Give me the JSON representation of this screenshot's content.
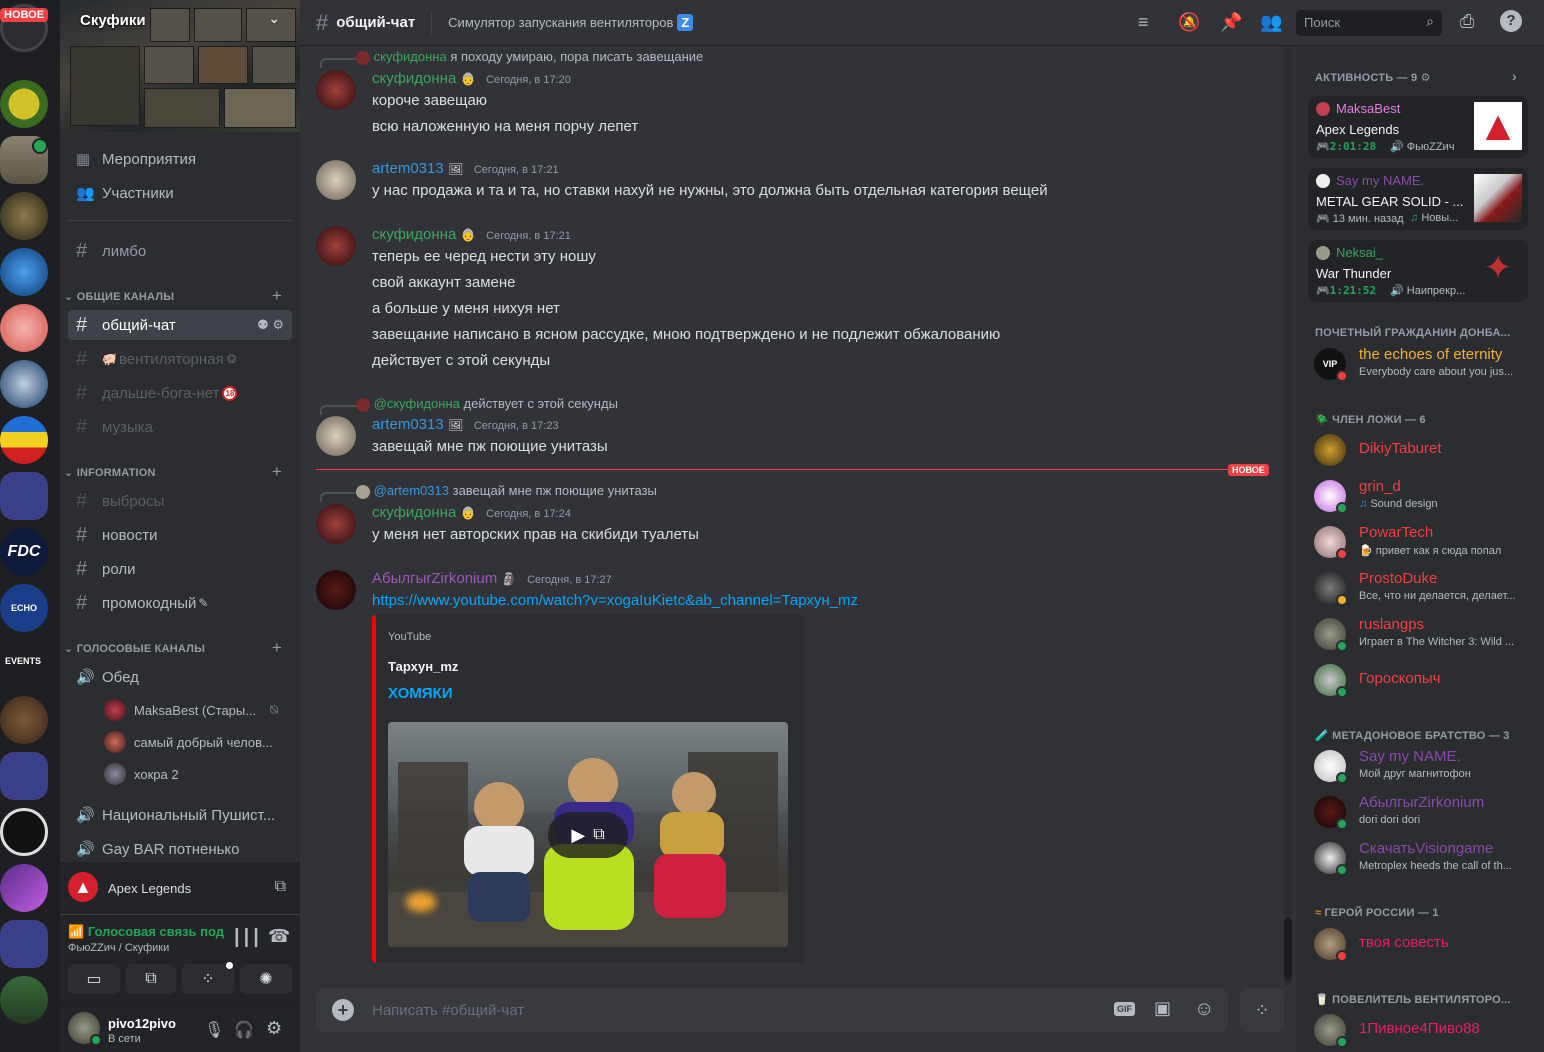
{
  "servers": {
    "new_badge": "НОВОЕ",
    "events_label": "EVENTS"
  },
  "server": {
    "name": "Скуфики"
  },
  "nav": {
    "events": "Мероприятия",
    "members": "Участники"
  },
  "channels": {
    "top": [
      {
        "name": "лимбо"
      }
    ],
    "categories": [
      {
        "name": "ОБЩИЕ КАНАЛЫ",
        "channels": [
          "общий-чат",
          "вентиляторная",
          "дальше-бога-нет",
          "музыка"
        ]
      },
      {
        "name": "INFORMATION",
        "channels": [
          "выбросы",
          "новости",
          "роли",
          "промокодный"
        ]
      },
      {
        "name": "ГОЛОСОВЫЕ КАНАЛЫ",
        "channels": [
          "Обед",
          "Национальный Пушист...",
          "Gay BAR потненько"
        ]
      }
    ],
    "voice_users": [
      "MaksaBest (Стары...",
      "самый добрый челов...",
      "хокра 2"
    ]
  },
  "activity_panel": {
    "game": "Apex Legends"
  },
  "voice_status": {
    "title": "Голосовая связь под",
    "subtitle": "ФьюZZич / Скуфики"
  },
  "user_panel": {
    "name": "pivo12pivo",
    "status": "В сети"
  },
  "topbar": {
    "channel": "общий-чат",
    "topic": "Симулятор запускания вентиляторов",
    "topic_badge": "Z",
    "search_placeholder": "Поиск"
  },
  "messages": [
    {
      "reply_name": "скуфидонна",
      "reply_text": "я походу умираю, пора писать завещание",
      "author": "скуфидонна",
      "time": "Сегодня, в 17:20",
      "lines": [
        "короче завещаю",
        "всю наложенную на меня порчу лепет"
      ]
    },
    {
      "author": "artem0313",
      "time": "Сегодня, в 17:21",
      "lines": [
        "у нас продажа и та и та, но ставки нахуй не нужны, это должна быть отдельная категория вещей"
      ]
    },
    {
      "author": "скуфидонна",
      "time": "Сегодня, в 17:21",
      "lines": [
        "теперь ее черед нести эту ношу",
        "свой аккаунт замене",
        "а больше у меня нихуя нет",
        "завещание написано в ясном рассудке, мною подтверждено и не подлежит обжалованию",
        "действует с этой секунды"
      ]
    },
    {
      "reply_name": "@скуфидонна",
      "reply_text": "действует с этой секунды",
      "author": "artem0313",
      "time": "Сегодня, в 17:23",
      "lines": [
        "завещай мне пж поющие унитазы"
      ]
    },
    {
      "reply_name": "@artem0313",
      "reply_text": "завещай мне пж поющие унитазы",
      "author": "скуфидонна",
      "time": "Сегодня, в 17:24",
      "lines": [
        "у меня нет авторских прав на скибиди туалеты"
      ]
    },
    {
      "author": "AбылгыrZirkonium",
      "time": "Сегодня, в 17:27",
      "link": "https://www.youtube.com/watch?v=xogaIuKietc&ab_channel=Тархун_mz"
    }
  ],
  "new_divider": "НОВОЕ",
  "embed": {
    "provider": "YouTube",
    "author": "Тархун_mz",
    "title": "ХОМЯКИ"
  },
  "composer": {
    "placeholder": "Написать #общий-чат",
    "gif": "GIF"
  },
  "members_panel": {
    "activity_header": "АКТИВНОСТЬ — 9",
    "activities": [
      {
        "user": "MaksaBest",
        "game": "Apex Legends",
        "time": "2:01:28",
        "extra": "ФьюZZич"
      },
      {
        "user": "Say my NAME.",
        "game": "METAL GEAR SOLID - ...",
        "time": "13 мин. назад",
        "extra": "Новы..."
      },
      {
        "user": "Neksai_",
        "game": "War Thunder",
        "time": "1:21:52",
        "extra": "Наипрекр..."
      }
    ],
    "groups": [
      {
        "name": "ПОЧЕТНЫЙ ГРАЖДАНИН ДОНБА...",
        "members": [
          {
            "name": "the echoes of eternity",
            "status": "Everybody care about you jus...",
            "color": "#f0b132"
          }
        ]
      },
      {
        "name": "ЧЛЕН ЛОЖИ — 6",
        "members": [
          {
            "name": "DikiyTaburet",
            "status": "",
            "color": "#f23f43"
          },
          {
            "name": "grin_d",
            "status": "Sound design",
            "color": "#f23f43"
          },
          {
            "name": "PowarTech",
            "status": "привет как я сюда попал",
            "color": "#f23f43"
          },
          {
            "name": "ProstoDuke",
            "status": "Все, что ни делается, делает...",
            "color": "#f23f43"
          },
          {
            "name": "ruslangps",
            "status": "Играет в The Witcher 3: Wild ...",
            "color": "#f23f43"
          },
          {
            "name": "Гороскопыч",
            "status": "",
            "color": "#f23f43"
          }
        ]
      },
      {
        "name": "МЕТАДОНОВОЕ БРАТСТВО — 3",
        "members": [
          {
            "name": "Say my NAME.",
            "status": "Мой друг магнитофон",
            "color": "#9b59b6"
          },
          {
            "name": "AбылгыrZirkonium",
            "status": "dori dori dori",
            "color": "#9b59b6"
          },
          {
            "name": "СкачатьVisiongame",
            "status": "Metroplex heeds the call of th...",
            "color": "#9b59b6"
          }
        ]
      },
      {
        "name": "ГЕРОЙ РОССИИ — 1",
        "members": [
          {
            "name": "твоя совесть",
            "status": "",
            "color": "#e91e63"
          }
        ]
      },
      {
        "name": "ПОВЕЛИТЕЛЬ ВЕНТИЛЯТОРО...",
        "members": [
          {
            "name": "1Пивное4Пиво88",
            "status": "",
            "color": "#e91e63"
          }
        ]
      }
    ]
  },
  "colors": {
    "green_name": "#3ba55c",
    "blue_name": "#3498db",
    "purple_name": "#9b59b6",
    "link": "#00a8fc"
  }
}
